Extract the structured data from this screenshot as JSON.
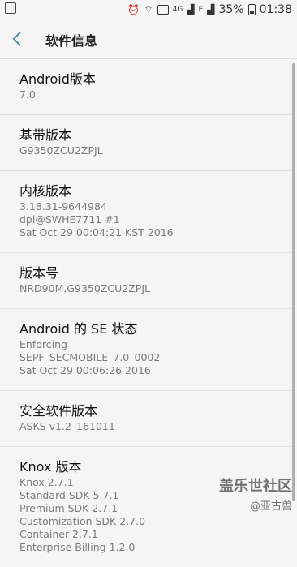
{
  "status_bar": {
    "icons": [
      "sim-icon",
      "alarm-icon",
      "wifi-icon",
      "data-4g-icon",
      "signal-icon",
      "battery-icon"
    ],
    "battery": "35%",
    "time": "01:38"
  },
  "header": {
    "title": "软件信息"
  },
  "items": [
    {
      "title": "Android版本",
      "value": "7.0"
    },
    {
      "title": "基带版本",
      "value": "G9350ZCU2ZPJL"
    },
    {
      "title": "内核版本",
      "value": "3.18.31-9644984\ndpi@SWHE7711 #1\nSat Oct 29 00:04:21 KST 2016"
    },
    {
      "title": "版本号",
      "value": "NRD90M.G9350ZCU2ZPJL"
    },
    {
      "title": "Android 的 SE 状态",
      "value": "Enforcing\nSEPF_SECMOBILE_7.0_0002\nSat Oct 29 00:06:26 2016"
    },
    {
      "title": "安全软件版本",
      "value": "ASKS v1.2_161011"
    },
    {
      "title": "Knox 版本",
      "value": "Knox 2.7.1\nStandard SDK 5.7.1\nPremium SDK 2.7.1\nCustomization SDK 2.7.0\nContainer 2.7.1\nEnterprise Billing 1.2.0"
    }
  ],
  "watermark": {
    "brand": "盖乐世社区",
    "user": "@亚古兽"
  }
}
